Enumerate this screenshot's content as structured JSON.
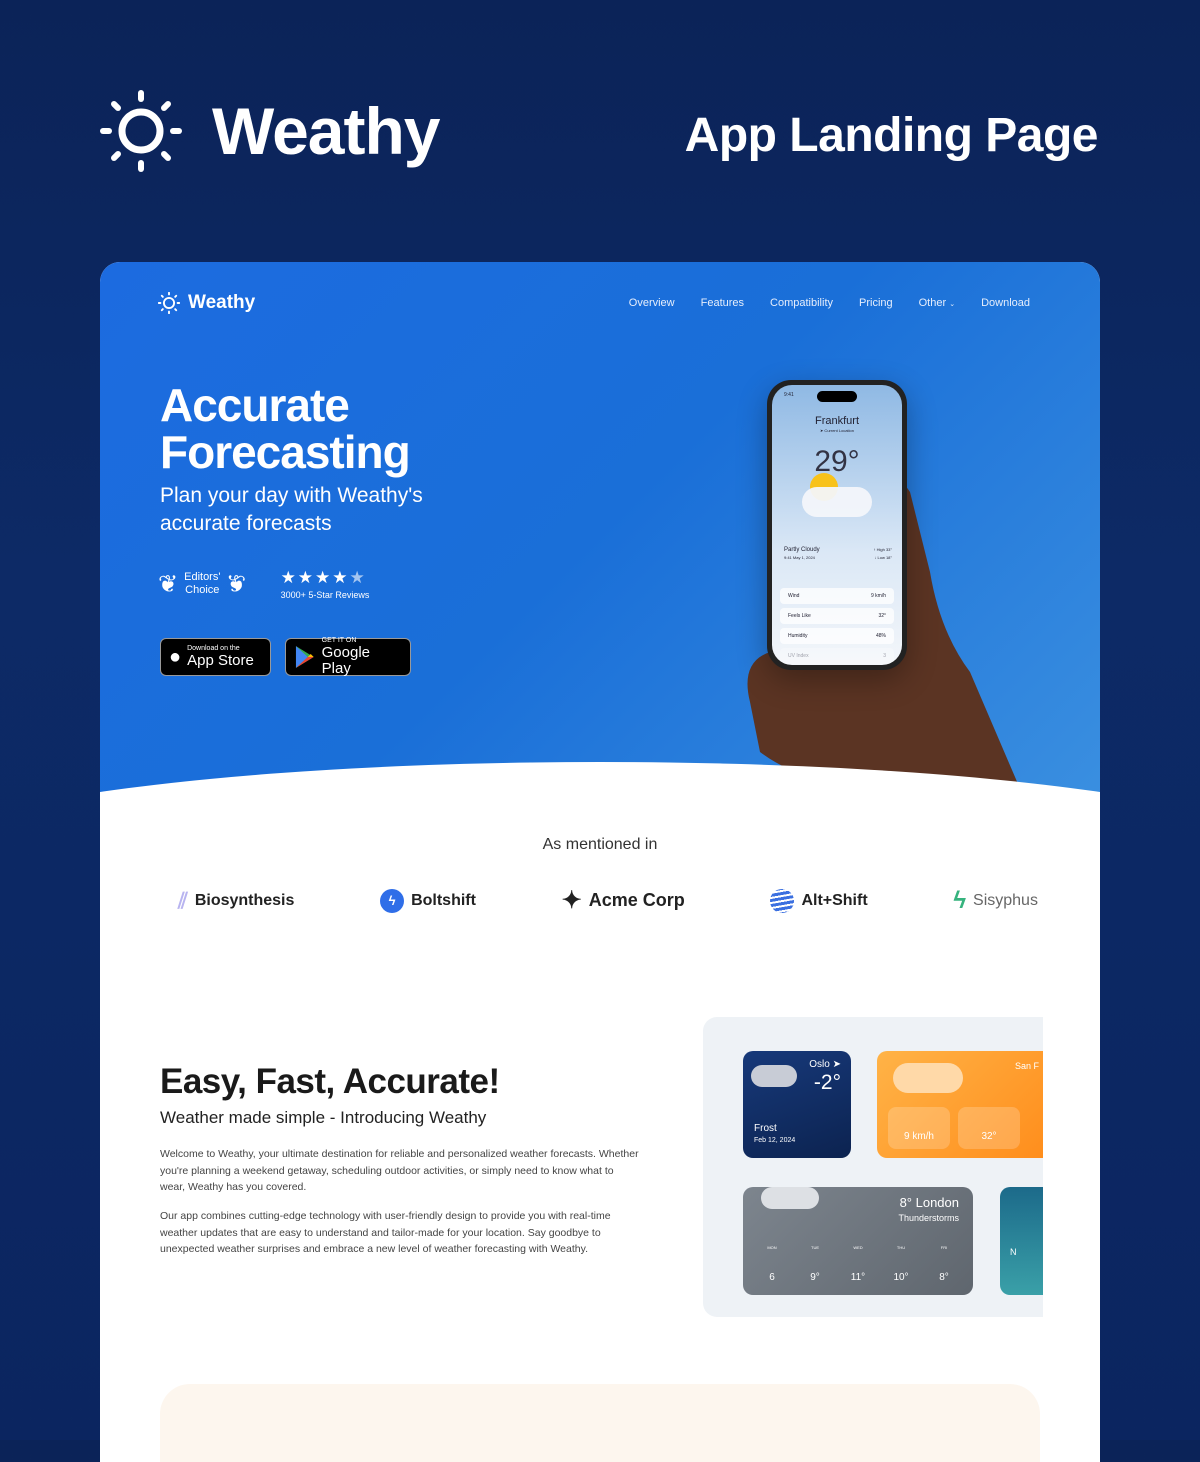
{
  "header": {
    "brand": "Weathy",
    "tagline": "App Landing Page"
  },
  "nav": {
    "logo": "Weathy",
    "items": [
      "Overview",
      "Features",
      "Compatibility",
      "Pricing",
      "Other",
      "Download"
    ]
  },
  "hero": {
    "title": "Accurate Forecasting",
    "subtitle": "Plan your day with Weathy's accurate forecasts",
    "award_line1": "Editors'",
    "award_line2": "Choice",
    "stars": "★★★★",
    "half_star": "★",
    "rating": 4.5,
    "reviews": "3000+ 5-Star Reviews",
    "appstore_small": "Download on the",
    "appstore_big": "App Store",
    "gplay_small": "GET IT ON",
    "gplay_big": "Google Play"
  },
  "phone": {
    "time": "9:41",
    "city": "Frankfurt",
    "loc": "➤ Current Location",
    "temp": "29°",
    "cond": "Partly Cloudy",
    "date": "9:41  May 1, 2024",
    "high": "↑ High 33°",
    "low": "↓ Low 18°",
    "rows": [
      {
        "label": "Wind",
        "value": "9 km/h"
      },
      {
        "label": "Feels Like",
        "value": "32°"
      },
      {
        "label": "Humidity",
        "value": "48%"
      },
      {
        "label": "UV Index",
        "value": "3"
      }
    ]
  },
  "mentions": {
    "title": "As mentioned in",
    "logos": [
      "Biosynthesis",
      "Boltshift",
      "Acme Corp",
      "Alt+Shift",
      "Sisyphus"
    ]
  },
  "about": {
    "title": "Easy, Fast, Accurate!",
    "subtitle": "Weather made simple - Introducing Weathy",
    "p1": "Welcome to Weathy, your ultimate destination for reliable and personalized weather forecasts. Whether you're planning a weekend getaway, scheduling outdoor activities, or simply need to know what to wear, Weathy has you covered.",
    "p2": "Our app combines cutting-edge technology with user-friendly design to provide you with real-time weather updates that are easy to understand and tailor-made for your location. Say goodbye to unexpected weather surprises and embrace a new level of weather forecasting with Weathy."
  },
  "widgets": {
    "oslo": {
      "city": "Oslo ➤",
      "temp": "-2°",
      "cond": "Frost",
      "date": "Feb 12, 2024"
    },
    "sf": {
      "city": "San F",
      "wind": "9 km/h",
      "temp": "32°"
    },
    "london": {
      "title": "8°  London",
      "cond": "Thunderstorms",
      "days": [
        {
          "d": "MON",
          "t": "6"
        },
        {
          "d": "TUE",
          "t": "9°"
        },
        {
          "d": "WED",
          "t": "11°"
        },
        {
          "d": "THU",
          "t": "10°"
        },
        {
          "d": "FRI",
          "t": "8°"
        }
      ]
    },
    "ny": {
      "city": "N"
    }
  },
  "colors": {
    "bg": "#0b2358",
    "hero": "#1c6be0",
    "oslo": "#0e2a5c",
    "sf": "#ff9a2e",
    "london": "#6f7780"
  }
}
